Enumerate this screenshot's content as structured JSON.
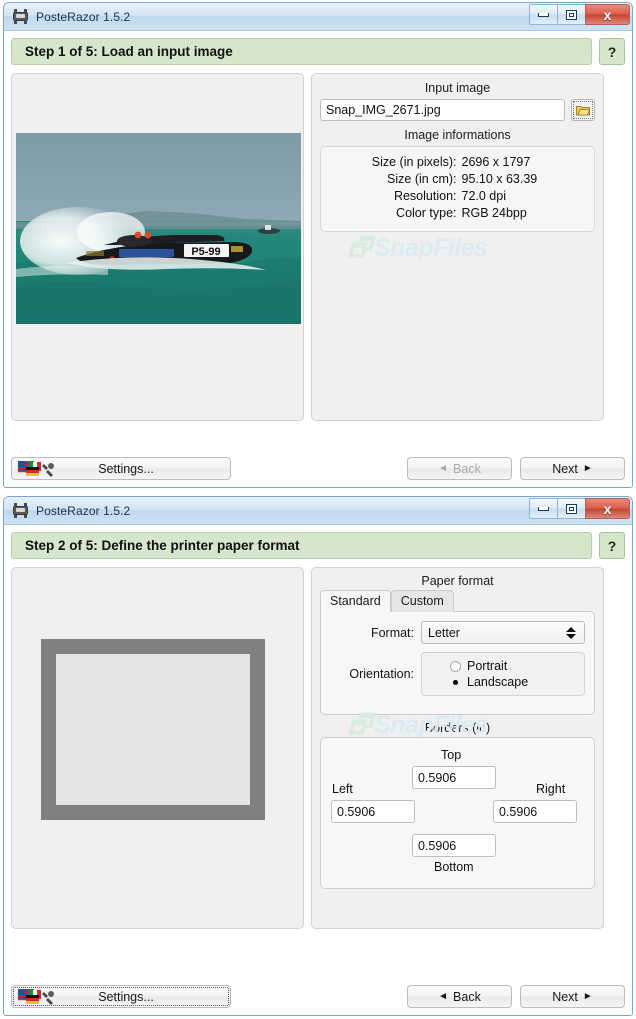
{
  "app": {
    "title": "PosteRazor 1.5.2",
    "icon": "printer-icon",
    "watermark": "SnapFiles"
  },
  "window_controls": {
    "minimize": "minimize-icon",
    "maximize": "maximize-icon",
    "close_label": "x"
  },
  "window1": {
    "title": "PosteRazor 1.5.2",
    "step_header": "Step 1 of 5: Load an input image",
    "help_label": "?",
    "input_image": {
      "group_label": "Input image",
      "value": "Snap_IMG_2671.jpg",
      "browse_icon": "folder-open-icon"
    },
    "image_info": {
      "group_label": "Image informations",
      "rows": [
        {
          "key": "Size (in pixels):",
          "value": "2696 x 1797"
        },
        {
          "key": "Size (in cm):",
          "value": "95.10 x 63.39"
        },
        {
          "key": "Resolution:",
          "value": "72.0 dpi"
        },
        {
          "key": "Color type:",
          "value": "RGB 24bpp"
        }
      ]
    },
    "footer": {
      "settings_label": "Settings...",
      "back_label": "Back",
      "next_label": "Next",
      "back_enabled": false,
      "settings_focused": false
    }
  },
  "window2": {
    "title": "PosteRazor 1.5.2",
    "step_header": "Step 2 of 5: Define the printer paper format",
    "help_label": "?",
    "paper_format": {
      "group_label": "Paper format",
      "tabs": [
        {
          "label": "Standard",
          "active": true
        },
        {
          "label": "Custom",
          "active": false
        }
      ],
      "format_label": "Format:",
      "format_value": "Letter",
      "orientation_label": "Orientation:",
      "orientation_options": [
        {
          "label": "Portrait",
          "selected": false
        },
        {
          "label": "Landscape",
          "selected": true
        }
      ]
    },
    "borders": {
      "group_label": "Borders (in)",
      "top_label": "Top",
      "bottom_label": "Bottom",
      "left_label": "Left",
      "right_label": "Right",
      "top_value": "0.5906",
      "bottom_value": "0.5906",
      "left_value": "0.5906",
      "right_value": "0.5906"
    },
    "footer": {
      "settings_label": "Settings...",
      "back_label": "Back",
      "next_label": "Next",
      "back_enabled": true,
      "settings_focused": true
    }
  },
  "colors": {
    "step_header_bg": "#d6e6cc",
    "titlebar": "#cfe2f3",
    "close_button": "#c04430",
    "window_border": "#7aa8cc",
    "paper_border_preview": "#808080"
  }
}
